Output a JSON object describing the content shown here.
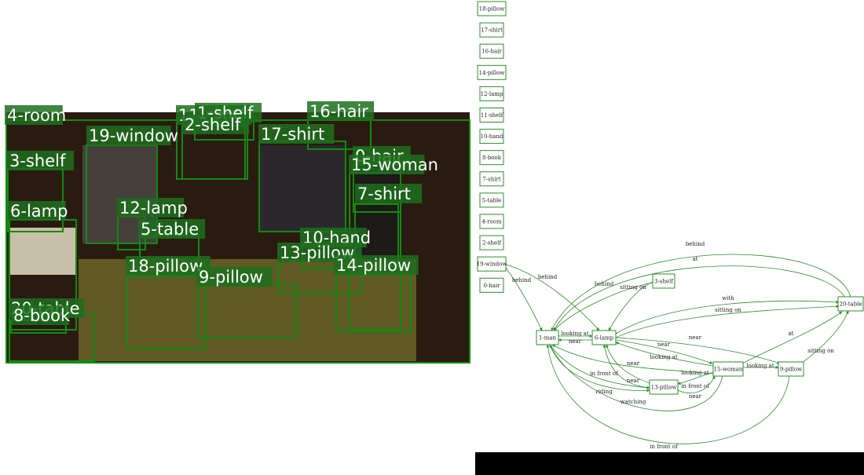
{
  "detections": [
    {
      "label": "4-room"
    },
    {
      "label": "11-shelf"
    },
    {
      "label": "1-shelf"
    },
    {
      "label": "2-shelf"
    },
    {
      "label": "16-hair"
    },
    {
      "label": "19-window"
    },
    {
      "label": "17-shirt"
    },
    {
      "label": "3-shelf"
    },
    {
      "label": "0-hair"
    },
    {
      "label": "15-woman"
    },
    {
      "label": "7-shirt"
    },
    {
      "label": "6-lamp"
    },
    {
      "label": "12-lamp"
    },
    {
      "label": "5-table"
    },
    {
      "label": "10-hand"
    },
    {
      "label": "13-pillow"
    },
    {
      "label": "14-pillow"
    },
    {
      "label": "18-pillow"
    },
    {
      "label": "9-pillow"
    },
    {
      "label": "20-table"
    },
    {
      "label": "8-book"
    }
  ],
  "graph": {
    "isolated_nodes": [
      "18-pillow",
      "17-shirt",
      "16-hair",
      "14-pillow",
      "12-lamp",
      "11-shelf",
      "10-hand",
      "8-book",
      "7-shirt",
      "5-table",
      "4-room",
      "2-shelf",
      "19-window",
      "0-hair"
    ],
    "nodes": [
      "1-man",
      "6-lamp",
      "3-shelf",
      "20-table",
      "15-woman",
      "9-pillow",
      "13-pillow"
    ],
    "edges": [
      {
        "from": "19-window",
        "to": "1-man",
        "label": "behind"
      },
      {
        "from": "19-window",
        "to": "6-lamp",
        "label": "behind"
      },
      {
        "from": "3-shelf",
        "to": "1-man",
        "label": "behind"
      },
      {
        "from": "3-shelf",
        "to": "6-lamp",
        "label": "sitting on"
      },
      {
        "from": "20-table",
        "to": "1-man",
        "label": "behind"
      },
      {
        "from": "20-table",
        "to": "1-man",
        "label": "at"
      },
      {
        "from": "6-lamp",
        "to": "20-table",
        "label": "with"
      },
      {
        "from": "6-lamp",
        "to": "20-table",
        "label": "sitting on"
      },
      {
        "from": "1-man",
        "to": "6-lamp",
        "label": "looking at"
      },
      {
        "from": "6-lamp",
        "to": "1-man",
        "label": "near"
      },
      {
        "from": "6-lamp",
        "to": "9-pillow",
        "label": "near"
      },
      {
        "from": "6-lamp",
        "to": "15-woman",
        "label": "near"
      },
      {
        "from": "15-woman",
        "to": "6-lamp",
        "label": "looking at"
      },
      {
        "from": "15-woman",
        "to": "20-table",
        "label": "at"
      },
      {
        "from": "15-woman",
        "to": "9-pillow",
        "label": "looking at"
      },
      {
        "from": "9-pillow",
        "to": "20-table",
        "label": "sitting on"
      },
      {
        "from": "13-pillow",
        "to": "6-lamp",
        "label": "near"
      },
      {
        "from": "13-pillow",
        "to": "6-lamp",
        "label": "near"
      },
      {
        "from": "15-woman",
        "to": "13-pillow",
        "label": "looking at"
      },
      {
        "from": "15-woman",
        "to": "1-man",
        "label": "in front of"
      },
      {
        "from": "1-man",
        "to": "13-pillow",
        "label": "in front of"
      },
      {
        "from": "1-man",
        "to": "13-pillow",
        "label": "riding"
      },
      {
        "from": "13-pillow",
        "to": "15-woman",
        "label": "near"
      },
      {
        "from": "15-woman",
        "to": "1-man",
        "label": "watching"
      },
      {
        "from": "9-pillow",
        "to": "1-man",
        "label": "in front of"
      }
    ]
  }
}
